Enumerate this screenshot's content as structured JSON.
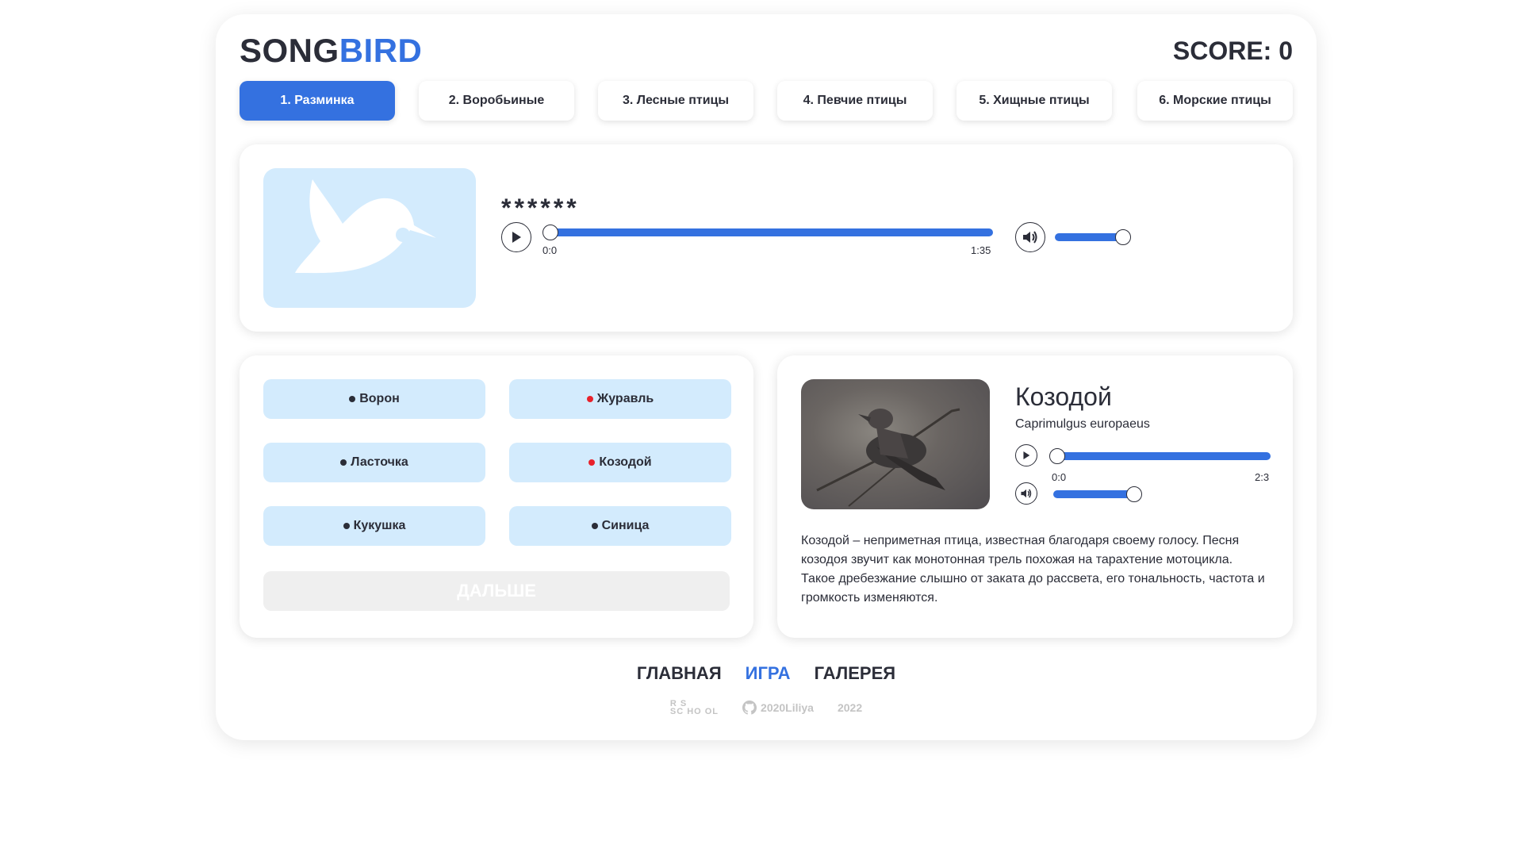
{
  "header": {
    "logo_part1": "SONG",
    "logo_part2": "BIRD",
    "score_label": "SCORE: 0"
  },
  "tabs": [
    {
      "label": "1. Разминка",
      "active": true
    },
    {
      "label": "2. Воробьиные",
      "active": false
    },
    {
      "label": "3. Лесные птицы",
      "active": false
    },
    {
      "label": "4. Певчие птицы",
      "active": false
    },
    {
      "label": "5. Хищные птицы",
      "active": false
    },
    {
      "label": "6. Морские птицы",
      "active": false
    }
  ],
  "question": {
    "hidden_name": "******",
    "player": {
      "current_time": "0:0",
      "duration": "1:35",
      "progress": 0.0,
      "volume": 1.0
    }
  },
  "answers": [
    {
      "label": "Ворон",
      "state": "neutral"
    },
    {
      "label": "Журавль",
      "state": "wrong"
    },
    {
      "label": "Ласточка",
      "state": "neutral"
    },
    {
      "label": "Козодой",
      "state": "wrong"
    },
    {
      "label": "Кукушка",
      "state": "neutral"
    },
    {
      "label": "Синица",
      "state": "neutral"
    }
  ],
  "next_label": "ДАЛЬШЕ",
  "info": {
    "name": "Козодой",
    "latin": "Caprimulgus europaeus",
    "player": {
      "current_time": "0:0",
      "duration": "2:3",
      "progress": 0.0,
      "volume": 0.75
    },
    "description": "Козодой – неприметная птица, известная благодаря своему голосу. Песня козодоя звучит как монотонная трель похожая на тарахтение мотоцикла. Такое дребезжание слышно от заката до рассвета, его тональность, частота и громкость изменяются."
  },
  "footer": {
    "nav": [
      {
        "label": "ГЛАВНАЯ",
        "active": false
      },
      {
        "label": "ИГРА",
        "active": true
      },
      {
        "label": "ГАЛЕРЕЯ",
        "active": false
      }
    ],
    "school_logo_line1": "R    S",
    "school_logo_line2": "SC HO OL",
    "github_user": "2020Liliya",
    "year": "2022"
  },
  "colors": {
    "accent": "#3471e0",
    "answer_bg": "#d3ebfd",
    "wrong_dot": "#e8212b",
    "neutral_dot": "#2b2d38",
    "text": "#2b2d38"
  },
  "icons": [
    "bird-silhouette-icon",
    "play-icon",
    "volume-icon",
    "github-icon"
  ]
}
